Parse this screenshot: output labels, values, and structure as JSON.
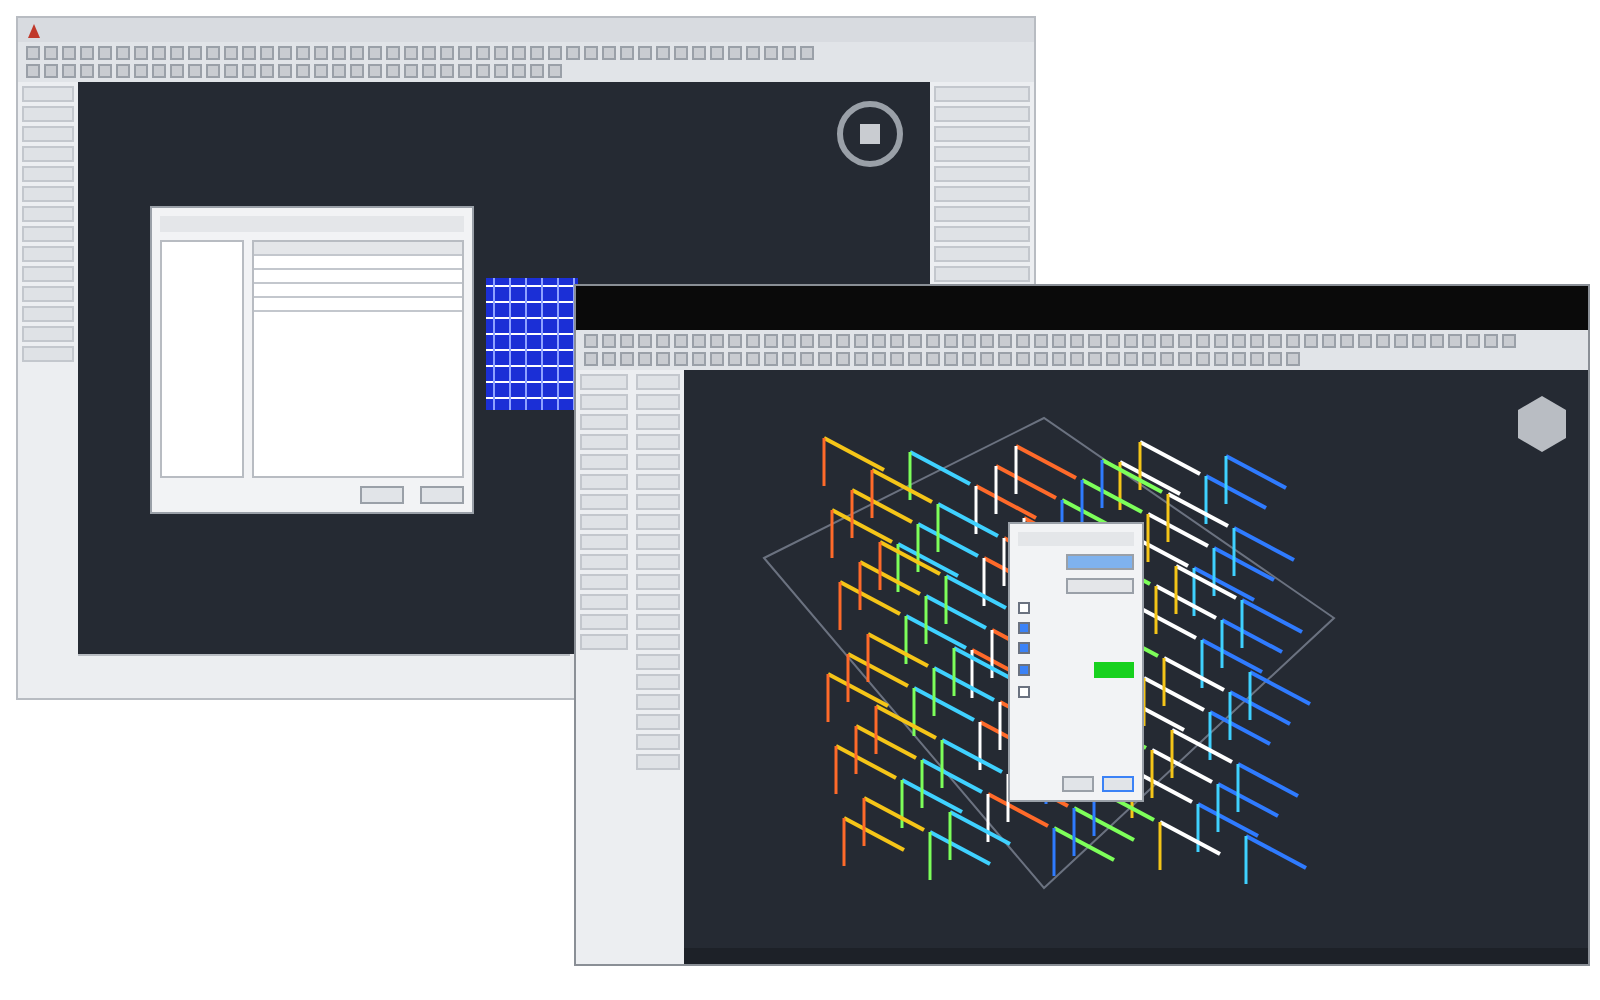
{
  "windows": [
    {
      "kind": "plan"
    },
    {
      "kind": "model"
    }
  ],
  "display_options": [
    {
      "checked": false
    },
    {
      "checked": true
    },
    {
      "checked": true
    },
    {
      "checked": true
    },
    {
      "checked": false
    }
  ]
}
